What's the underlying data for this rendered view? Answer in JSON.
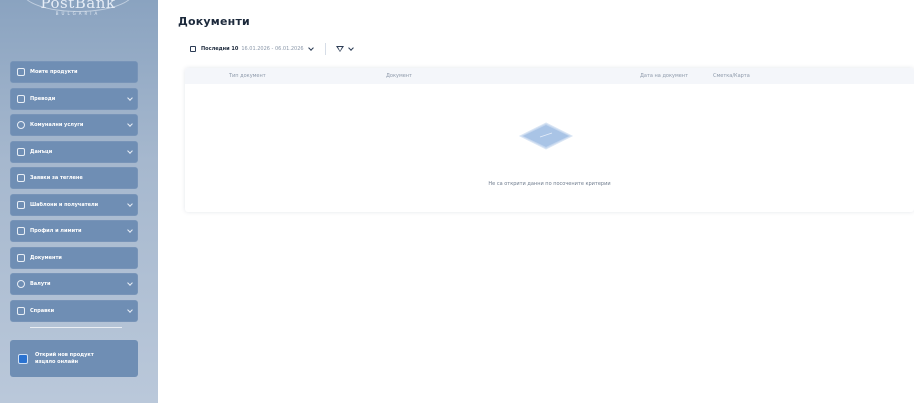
{
  "logo": {
    "name": "PostBank",
    "subtitle": "BULGARIA"
  },
  "colors": {
    "sidebar_item_bg": "#6f8eb4",
    "promo_icon": "#2a72d0",
    "empty_illustration": "#a9c4e6"
  },
  "sidebar": {
    "items": [
      {
        "label": "Моите продукти",
        "icon": "square-icon",
        "has_chevron": false
      },
      {
        "label": "Преводи",
        "icon": "transfer-icon",
        "has_chevron": true
      },
      {
        "label": "Комунални услуги",
        "icon": "bulb-icon",
        "has_chevron": true
      },
      {
        "label": "Данъци",
        "icon": "tax-icon",
        "has_chevron": true
      },
      {
        "label": "Заявки за теглене",
        "icon": "bank-icon",
        "has_chevron": false
      },
      {
        "label": "Шаблони и получатели",
        "icon": "template-icon",
        "has_chevron": true
      },
      {
        "label": "Профил и лимити",
        "icon": "profile-icon",
        "has_chevron": true
      },
      {
        "label": "Документи",
        "icon": "document-icon",
        "has_chevron": false
      },
      {
        "label": "Валути",
        "icon": "currency-icon",
        "has_chevron": true
      },
      {
        "label": "Справки",
        "icon": "report-icon",
        "has_chevron": true
      }
    ],
    "promo": {
      "line1": "Открий нов продукт",
      "line2": "изцяло онлайн",
      "icon": "plus-icon"
    }
  },
  "main": {
    "title": "Документи",
    "filter": {
      "date_label": "Последни 10",
      "date_range": "16.01.2026 - 06.01.2026",
      "calendar_icon": "calendar-icon",
      "filter_icon": "funnel-icon"
    },
    "table": {
      "columns": [
        "Тип документ",
        "Документ",
        "Дата на документ",
        "Сметка/Карта"
      ],
      "empty_message": "Не са открити данни по посочените критерии"
    }
  }
}
